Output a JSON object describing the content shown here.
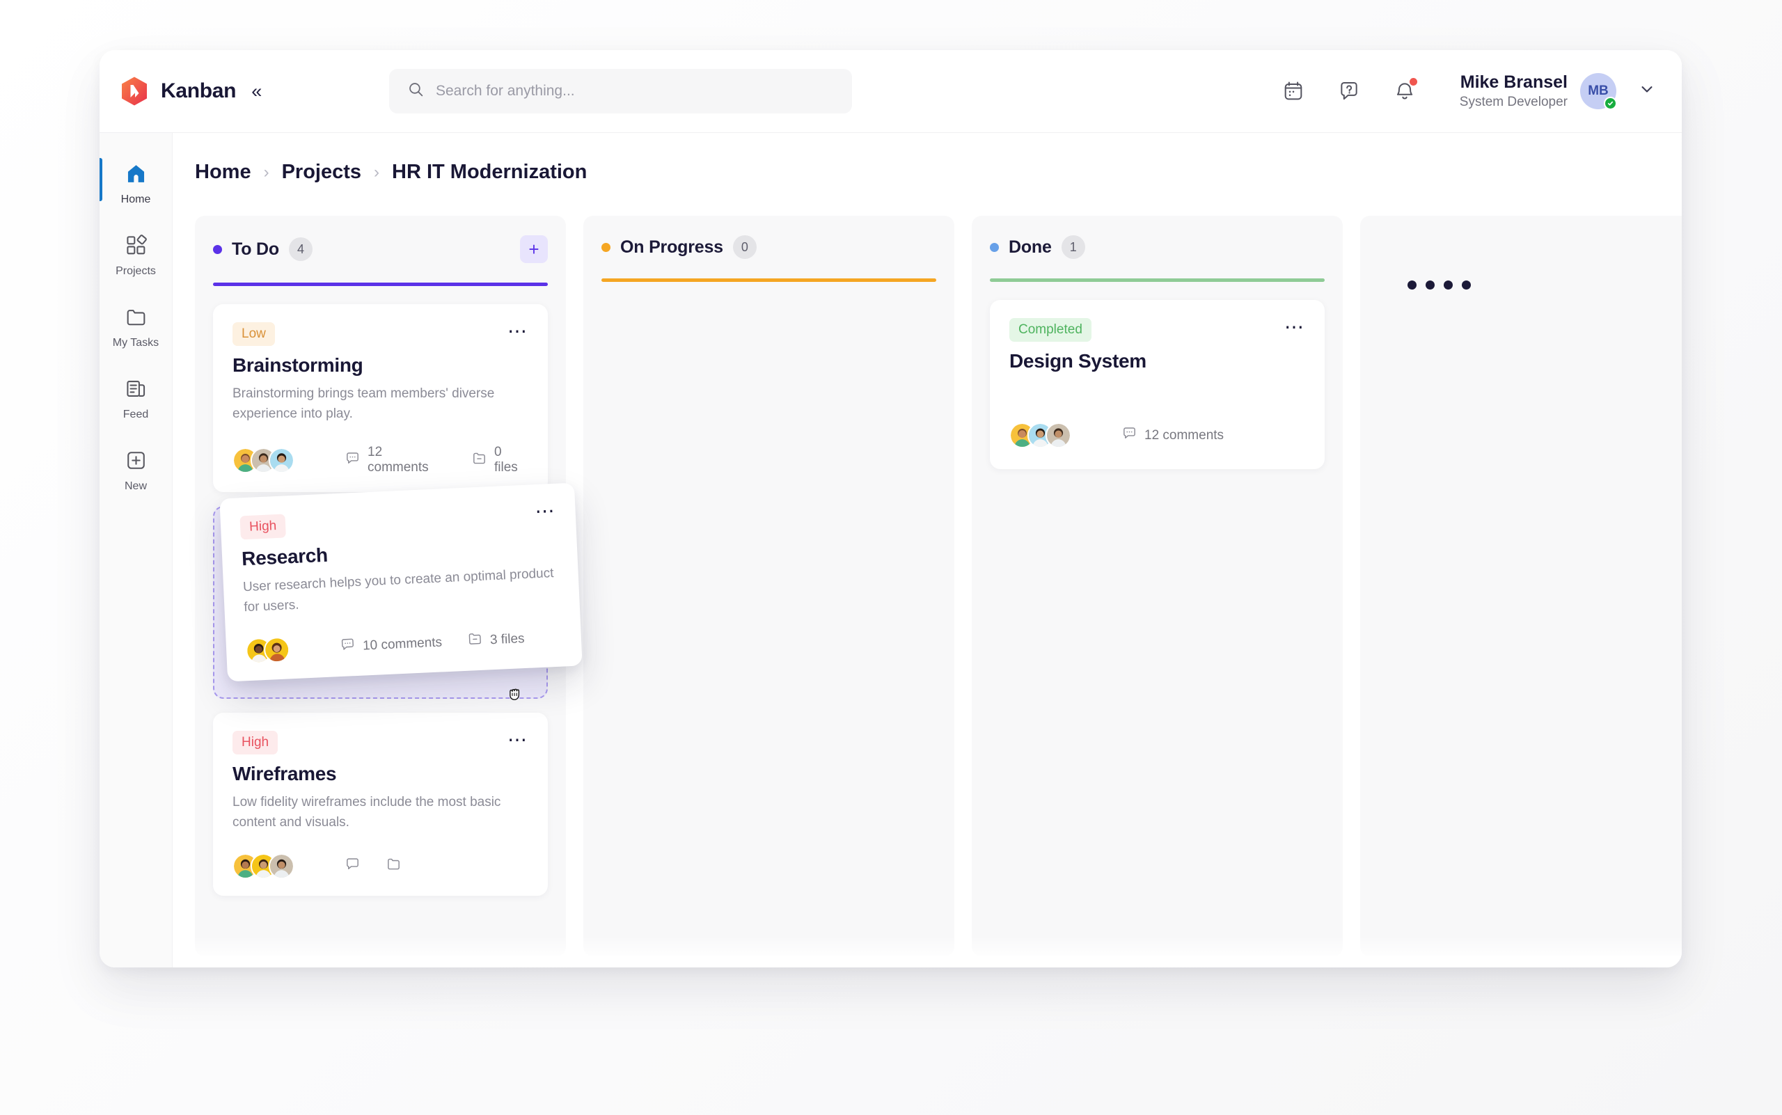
{
  "app": {
    "brand_name": "Kanban",
    "logo_icon": "kanban-hexagon-logo",
    "collapse_icon": "chevron-double-left-icon"
  },
  "search": {
    "placeholder": "Search for anything...",
    "value": "",
    "icon": "search-icon"
  },
  "header": {
    "icons": [
      {
        "name": "calendar-icon"
      },
      {
        "name": "help-icon"
      },
      {
        "name": "notification-bell-icon",
        "has_badge": true
      }
    ],
    "user": {
      "name": "Mike Bransel",
      "role": "System Developer",
      "initials": "MB",
      "avatar_bg": "#c5cef4",
      "avatar_text_color": "#3a4fa8",
      "status": "online",
      "status_color": "#17ad3f"
    },
    "dropdown_icon": "chevron-down-icon"
  },
  "sidebar": {
    "items": [
      {
        "label": "Home",
        "icon": "home-icon",
        "active": true
      },
      {
        "label": "Projects",
        "icon": "projects-grid-icon",
        "active": false
      },
      {
        "label": "My Tasks",
        "icon": "folder-icon",
        "active": false
      },
      {
        "label": "Feed",
        "icon": "feed-icon",
        "active": false
      },
      {
        "label": "New",
        "icon": "plus-square-icon",
        "active": false
      }
    ],
    "active_indicator_color": "#1678c8"
  },
  "breadcrumb": {
    "items": [
      "Home",
      "Projects",
      "HR IT Modernization"
    ],
    "separator": "›"
  },
  "board": {
    "columns": [
      {
        "title": "To Do",
        "count": "4",
        "dot_color": "#5b32e8",
        "rule_color": "#5b32e8",
        "add_label": "+",
        "has_add": true
      },
      {
        "title": "On Progress",
        "count": "0",
        "dot_color": "#f5a623",
        "rule_color": "#f5a623",
        "has_add": false
      },
      {
        "title": "Done",
        "count": "1",
        "dot_color": "#67a0e8",
        "rule_color": "#8fcb96",
        "has_add": false
      }
    ],
    "placeholder_column": {
      "dots": 4
    }
  },
  "cards": {
    "brainstorming": {
      "badge": "Low",
      "title": "Brainstorming",
      "description": "Brainstorming brings team members' diverse experience into play.",
      "comments": "12 comments",
      "files": "0 files",
      "menu_icon": "more-horizontal-icon",
      "comment_icon": "comment-icon",
      "file_icon": "file-folder-icon",
      "avatars": [
        "#f7c13c",
        "#cbbfae",
        "#a9dcf0"
      ]
    },
    "research": {
      "badge": "High",
      "title": "Research",
      "description": "User research helps you to create an optimal product for users.",
      "comments": "10 comments",
      "files": "3 files",
      "menu_icon": "more-horizontal-icon",
      "comment_icon": "comment-icon",
      "file_icon": "file-folder-icon",
      "avatars": [
        "#f5c518",
        "#f5c518"
      ],
      "state": "dragging",
      "cursor": "grabbing-hand-cursor"
    },
    "wireframes": {
      "badge": "High",
      "title": "Wireframes",
      "description": "Low fidelity wireframes include the most basic content and visuals.",
      "menu_icon": "more-horizontal-icon",
      "avatars": [
        "#f7c13c",
        "#f5c518",
        "#cbbfae"
      ]
    },
    "design_system": {
      "badge": "Completed",
      "title": "Design System",
      "description": "",
      "comments": "12 comments",
      "menu_icon": "more-horizontal-icon",
      "comment_icon": "comment-icon",
      "avatars": [
        "#f7c13c",
        "#a9dcf0",
        "#cbbfae"
      ]
    }
  }
}
